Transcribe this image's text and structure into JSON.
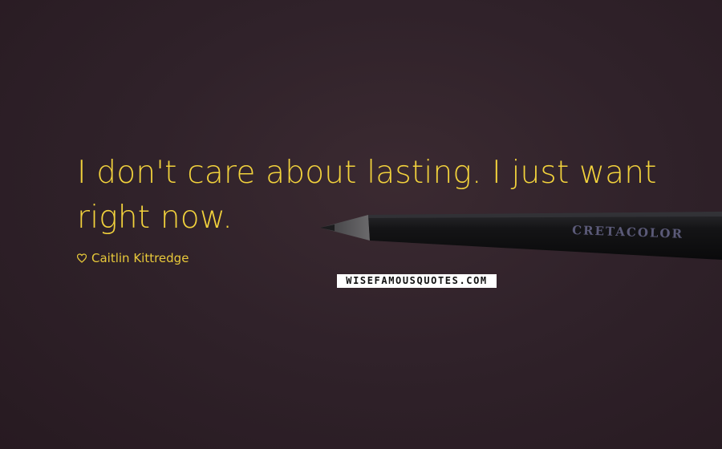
{
  "quote": {
    "line1": "I don't care about lasting. I just want",
    "line2": "right now."
  },
  "author": {
    "name": "Caitlin Kittredge",
    "icon": "heart-icon"
  },
  "watermark": {
    "text": "WISEFAMOUSQUOTES.COM"
  },
  "pencil": {
    "brand_text": "CRETACOLOR"
  },
  "colors": {
    "text": "#f2d23c",
    "background": "#30222a"
  }
}
